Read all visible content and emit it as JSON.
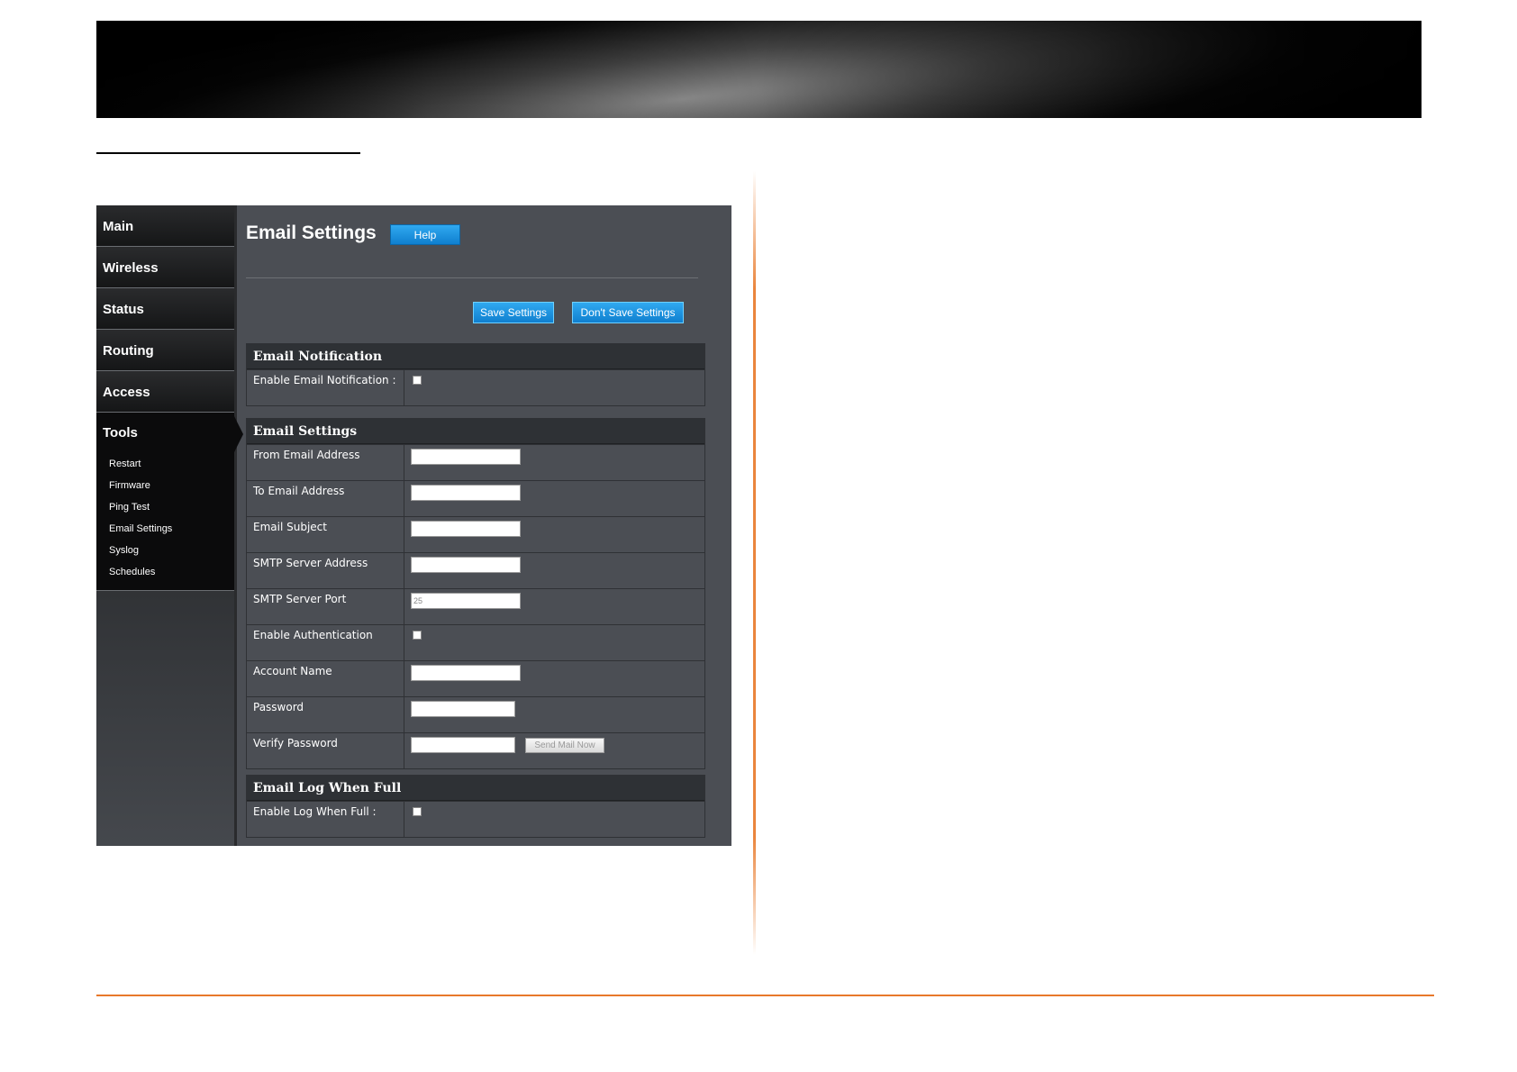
{
  "sidebar": {
    "items": [
      {
        "label": "Main"
      },
      {
        "label": "Wireless"
      },
      {
        "label": "Status"
      },
      {
        "label": "Routing"
      },
      {
        "label": "Access"
      }
    ],
    "active": {
      "label": "Tools",
      "subitems": [
        "Restart",
        "Firmware",
        "Ping Test",
        "Email Settings",
        "Syslog",
        "Schedules"
      ]
    }
  },
  "main": {
    "title": "Email Settings",
    "help_label": "Help",
    "save_label": "Save Settings",
    "dont_save_label": "Don't Save Settings"
  },
  "notification": {
    "header": "Email Notification",
    "enable_label": "Enable Email Notification :",
    "enabled": false
  },
  "settings": {
    "header": "Email Settings",
    "from_label": "From Email Address",
    "from_value": "",
    "to_label": "To Email Address",
    "to_value": "",
    "subject_label": "Email Subject",
    "subject_value": "",
    "smtp_addr_label": "SMTP Server Address",
    "smtp_addr_value": "",
    "smtp_port_label": "SMTP Server Port",
    "smtp_port_value": "25",
    "auth_label": "Enable Authentication",
    "auth_enabled": false,
    "account_label": "Account Name",
    "account_value": "",
    "password_label": "Password",
    "verify_label": "Verify Password",
    "send_mail_label": "Send Mail Now"
  },
  "log_full": {
    "header": "Email Log When Full",
    "enable_label": "Enable Log When Full :",
    "enabled": false
  },
  "colors": {
    "accent_blue": "#1a8fdc",
    "page_rule_orange": "#e8782a",
    "panel_bg": "#4b4e54"
  }
}
